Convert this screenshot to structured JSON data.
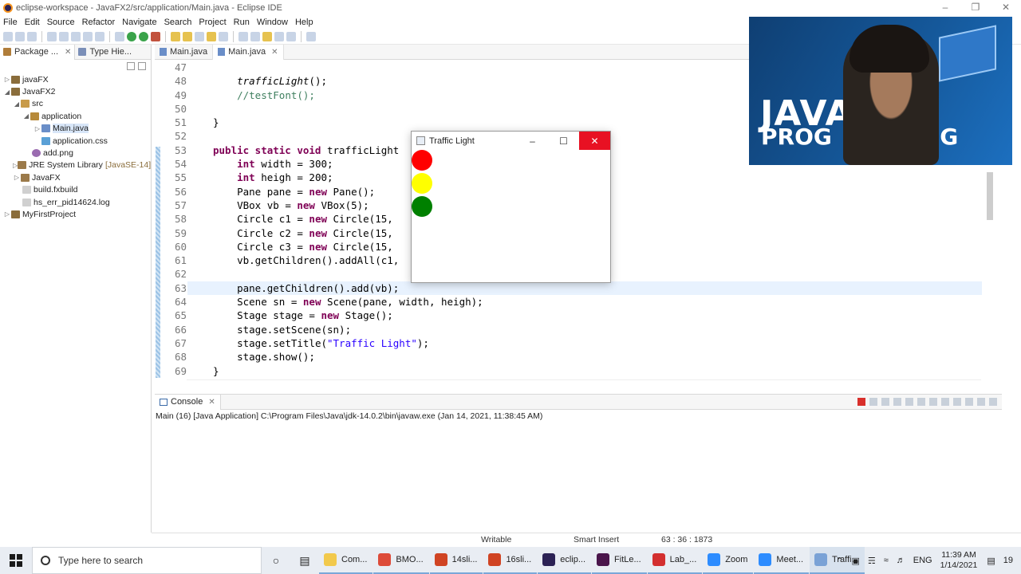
{
  "window": {
    "title": "eclipse-workspace - JavaFX2/src/application/Main.java - Eclipse IDE"
  },
  "menu": [
    "File",
    "Edit",
    "Source",
    "Refactor",
    "Navigate",
    "Search",
    "Project",
    "Run",
    "Window",
    "Help"
  ],
  "left_tabs": {
    "package": "Package ...",
    "type_hierarchy": "Type Hie..."
  },
  "tree": [
    {
      "label": "javaFX"
    },
    {
      "label": "JavaFX2"
    },
    {
      "label": "src"
    },
    {
      "label": "application"
    },
    {
      "label": "Main.java"
    },
    {
      "label": "application.css"
    },
    {
      "label": "add.png"
    },
    {
      "label": "JRE System Library",
      "suffix": "[JavaSE-14]"
    },
    {
      "label": "JavaFX"
    },
    {
      "label": "build.fxbuild"
    },
    {
      "label": "hs_err_pid14624.log"
    },
    {
      "label": "MyFirstProject"
    }
  ],
  "editor_tabs": [
    "Main.java",
    "Main.java"
  ],
  "line_numbers": [
    "47",
    "48",
    "49",
    "50",
    "51",
    "52",
    "53",
    "54",
    "55",
    "56",
    "57",
    "58",
    "59",
    "60",
    "61",
    "62",
    "63",
    "64",
    "65",
    "66",
    "67",
    "68",
    "69"
  ],
  "code": {
    "l48": "trafficLight",
    "l48b": "();",
    "l49": "//testFont();",
    "l51": "}",
    "l53a": "public static void",
    "l53b": " trafficLight",
    "l54a": "int",
    "l54b": " width = 300;",
    "l55a": "int",
    "l55b": " heigh = 200;",
    "l56a": "Pane pane = ",
    "l56b": "new",
    "l56c": " Pane();",
    "l57a": "VBox vb = ",
    "l57b": "new",
    "l57c": " VBox(5);",
    "l58a": "Circle c1 = ",
    "l58b": "new",
    "l58c": " Circle(15,",
    "l59a": "Circle c2 = ",
    "l59b": "new",
    "l59c": " Circle(15,",
    "l60a": "Circle c3 = ",
    "l60b": "new",
    "l60c": " Circle(15,",
    "l61": "vb.getChildren().addAll(c1,",
    "l63": "pane.getChildren().add(vb);",
    "l64a": "Scene sn = ",
    "l64b": "new",
    "l64c": " Scene(pane, width, heigh);",
    "l65a": "Stage stage = ",
    "l65b": "new",
    "l65c": " Stage();",
    "l66": "stage.setScene(sn);",
    "l67a": "stage.setTitle(",
    "l67b": "\"Traffic Light\"",
    "l67c": ");",
    "l68": "stage.show();",
    "l69": "}"
  },
  "fx_window": {
    "title": "Traffic Light",
    "lights": [
      {
        "color": "#ff0000"
      },
      {
        "color": "#ffff00"
      },
      {
        "color": "#008000"
      }
    ]
  },
  "video": {
    "line1": "JAVA",
    "line2": "PROG",
    "line2_end": "NG"
  },
  "console": {
    "tab": "Console",
    "info": "Main (16) [Java Application] C:\\Program Files\\Java\\jdk-14.0.2\\bin\\javaw.exe  (Jan 14, 2021, 11:38:45 AM)"
  },
  "status": {
    "writable": "Writable",
    "insert": "Smart Insert",
    "position": "63 : 36 : 1873"
  },
  "taskbar": {
    "search_placeholder": "Type here to search",
    "apps": [
      {
        "label": "Com...",
        "color": "#f2c94c"
      },
      {
        "label": "BMO...",
        "color": "#dd4b39"
      },
      {
        "label": "14sli...",
        "color": "#d04423"
      },
      {
        "label": "16sli...",
        "color": "#d04423"
      },
      {
        "label": "eclip...",
        "color": "#2c2255"
      },
      {
        "label": "FitLe...",
        "color": "#4a154b"
      },
      {
        "label": "Lab_...",
        "color": "#d32f2f"
      },
      {
        "label": "Zoom",
        "color": "#2d8cff"
      },
      {
        "label": "Meet...",
        "color": "#2d8cff"
      },
      {
        "label": "Traffi...",
        "color": "#7aa2d6"
      }
    ],
    "lang": "ENG",
    "time": "11:39 AM",
    "date": "1/14/2021",
    "notif": "19"
  }
}
